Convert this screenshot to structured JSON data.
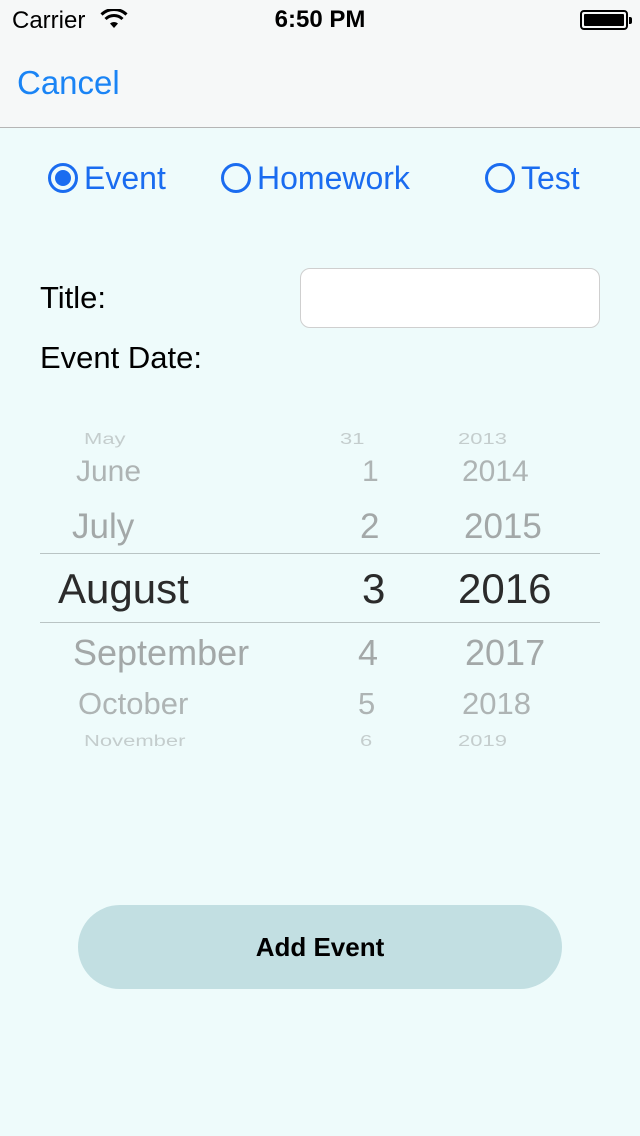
{
  "status_bar": {
    "carrier": "Carrier",
    "time": "6:50 PM",
    "wifi_icon": "wifi-icon",
    "battery_icon": "battery-icon"
  },
  "nav": {
    "cancel_label": "Cancel"
  },
  "event_type": {
    "selected": "Event",
    "options": [
      {
        "label": "Event",
        "selected": true
      },
      {
        "label": "Homework",
        "selected": false
      },
      {
        "label": "Test",
        "selected": false
      }
    ]
  },
  "form": {
    "title_label": "Title:",
    "title_value": "",
    "event_date_label": "Event Date:"
  },
  "date_picker": {
    "months": [
      "May",
      "June",
      "July",
      "August",
      "September",
      "October",
      "November"
    ],
    "days": [
      "31",
      "1",
      "2",
      "3",
      "4",
      "5",
      "6"
    ],
    "years": [
      "2013",
      "2014",
      "2015",
      "2016",
      "2017",
      "2018",
      "2019"
    ],
    "selected": {
      "month": "August",
      "day": "3",
      "year": "2016"
    }
  },
  "add_button_label": "Add Event",
  "colors": {
    "accent": "#1a84f5",
    "radio": "#1a6cf0",
    "background": "#eefbfb",
    "button": "#c2dfe2"
  }
}
